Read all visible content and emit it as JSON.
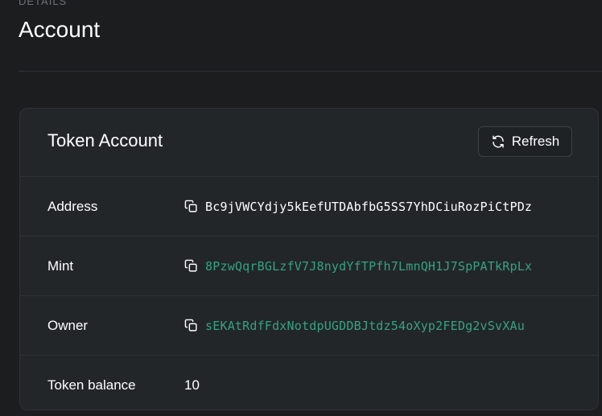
{
  "header": {
    "pretitle": "DETAILS",
    "title": "Account"
  },
  "card": {
    "title": "Token Account",
    "refresh_label": "Refresh",
    "rows": [
      {
        "label": "Address",
        "value": "Bc9jVWCYdjy5kEefUTDAbfbG5SS7YhDCiuRozPiCtPDz",
        "link": false
      },
      {
        "label": "Mint",
        "value": "8PzwQqrBGLzfV7J8nydYfTPfh7LmnQH1J7SpPATkRpLx",
        "link": true
      },
      {
        "label": "Owner",
        "value": "sEKAtRdfFdxNotdpUGDDBJtdz54oXyp2FEDg2vSvXAu",
        "link": true
      },
      {
        "label": "Token balance",
        "value": "10"
      }
    ]
  },
  "colors": {
    "background": "#1b1d1f",
    "card": "#232629",
    "link": "#33a382",
    "muted": "#6c7177"
  },
  "icons": {
    "refresh": "refresh-icon",
    "copy": "copy-icon"
  }
}
